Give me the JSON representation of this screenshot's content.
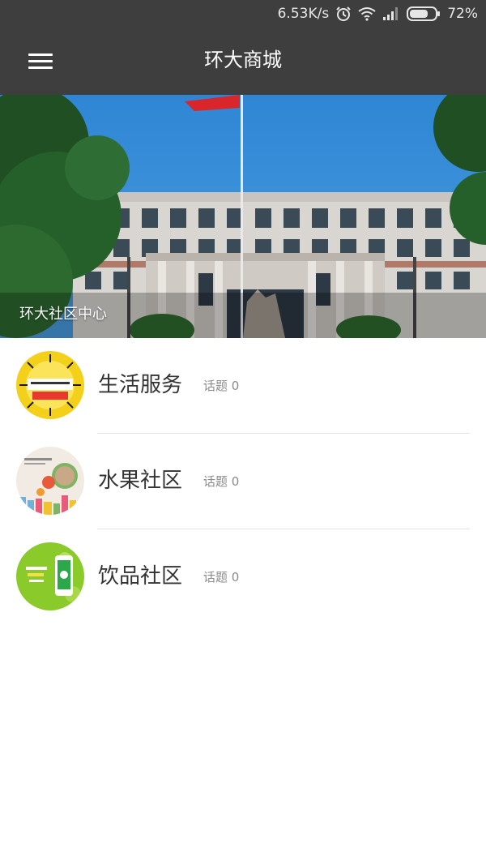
{
  "status_bar": {
    "network_speed": "6.53K/s",
    "battery_percent": "72%",
    "battery_level": 0.72,
    "icons": [
      "alarm-icon",
      "wifi-icon",
      "signal-icon",
      "battery-icon"
    ]
  },
  "app_bar": {
    "title": "环大商城",
    "menu_icon": "hamburger-menu-icon"
  },
  "banner": {
    "caption": "环大社区中心"
  },
  "communities": [
    {
      "name": "生活服务",
      "topic_label": "话题 0",
      "avatar_color": "#f3d11a"
    },
    {
      "name": "水果社区",
      "topic_label": "话题 0",
      "avatar_color": "#f1ebe3"
    },
    {
      "name": "饮品社区",
      "topic_label": "话题 0",
      "avatar_color": "#8acb2b"
    }
  ],
  "colors": {
    "app_bar_bg": "#3e3e3e",
    "text_primary": "#333333",
    "text_secondary": "#8c8c8c"
  }
}
